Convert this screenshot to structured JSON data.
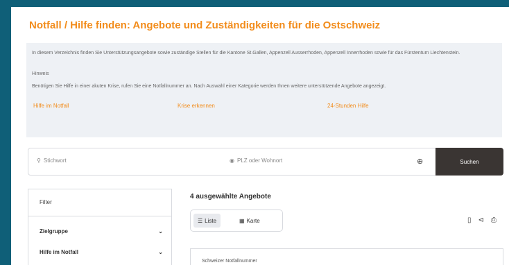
{
  "page": {
    "title": "Notfall / Hilfe finden: Angebote und Zuständigkeiten für die Ostschweiz"
  },
  "info": {
    "text1": "In diesem Verzeichnis finden Sie Unterstützungsangebote sowie zuständige Stellen für die Kantone St.Gallen, Appenzell Ausserrhoden, Appenzell Innerrhoden sowie für das Fürstentum Liechtenstein.",
    "text2": "Hinweis",
    "text3": "Benötigen Sie Hilfe in einer akuten Krise, rufen Sie eine Notfallnummer an. Nach Auswahl einer Kategorie werden Ihnen weitere unterstützende Angebote angezeigt.",
    "links": [
      "Hilfe im Notfall",
      "Krise erkennen",
      "24-Stunden Hilfe"
    ]
  },
  "search": {
    "keyword_placeholder": "Stichwort",
    "location_placeholder": "PLZ oder Wohnort",
    "button": "Suchen"
  },
  "filter": {
    "title": "Filter",
    "groups": [
      "Zielgruppe",
      "Hilfe im Notfall"
    ]
  },
  "results": {
    "count_label": "4 ausgewählte Angebote",
    "view_list": "Liste",
    "view_map": "Karte",
    "first_item": "Schweizer Notfallnummer"
  },
  "icons": {
    "search": "search-icon",
    "location": "location-pin-icon",
    "locate": "crosshair-icon",
    "bookmark": "bookmark-icon",
    "share": "share-icon",
    "print": "print-icon"
  }
}
